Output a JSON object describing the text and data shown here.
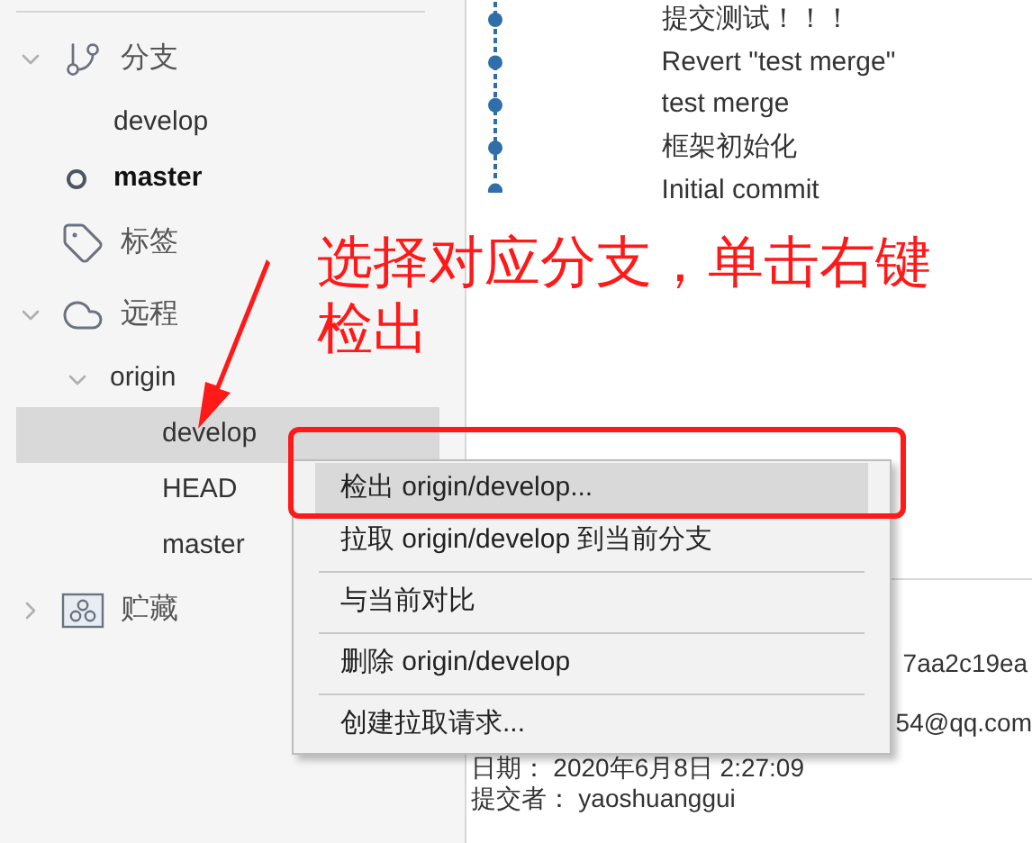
{
  "sidebar": {
    "sections": [
      {
        "label": "分支",
        "kind": "branches",
        "expanded": true,
        "children": [
          {
            "label": "develop",
            "current": false
          },
          {
            "label": "master",
            "current": true
          }
        ]
      },
      {
        "label": "标签",
        "kind": "tags"
      },
      {
        "label": "远程",
        "kind": "remotes",
        "expanded": true,
        "children": [
          {
            "label": "origin",
            "expanded": true,
            "children": [
              {
                "label": "develop",
                "selected": true
              },
              {
                "label": "HEAD",
                "selected": false
              },
              {
                "label": "master",
                "selected": false
              }
            ]
          }
        ]
      },
      {
        "label": "贮藏",
        "kind": "stashes",
        "expanded": false
      }
    ]
  },
  "commits": [
    {
      "message": "提交测试！！！"
    },
    {
      "message": "Revert \"test merge\""
    },
    {
      "message": "test merge"
    },
    {
      "message": "框架初始化"
    },
    {
      "message": "Initial commit"
    }
  ],
  "details": {
    "lines": [
      "7aa2c19ea",
      "54@qq.com",
      "日期： 2020年6月8日 2:27:09",
      "提交者： yaoshuanggui"
    ]
  },
  "annotation": {
    "lines": [
      "选择对应分支，单击右键",
      "检出"
    ]
  },
  "context_menu": {
    "items": [
      {
        "kind": "item",
        "label": "检出 origin/develop...",
        "selected": true
      },
      {
        "kind": "item",
        "label": "拉取 origin/develop 到当前分支",
        "selected": false
      },
      {
        "kind": "separator"
      },
      {
        "kind": "item",
        "label": "与当前对比",
        "selected": false
      },
      {
        "kind": "separator"
      },
      {
        "kind": "item",
        "label": "删除 origin/develop",
        "selected": false
      },
      {
        "kind": "separator"
      },
      {
        "kind": "item",
        "label": "创建拉取请求...",
        "selected": false
      }
    ]
  }
}
